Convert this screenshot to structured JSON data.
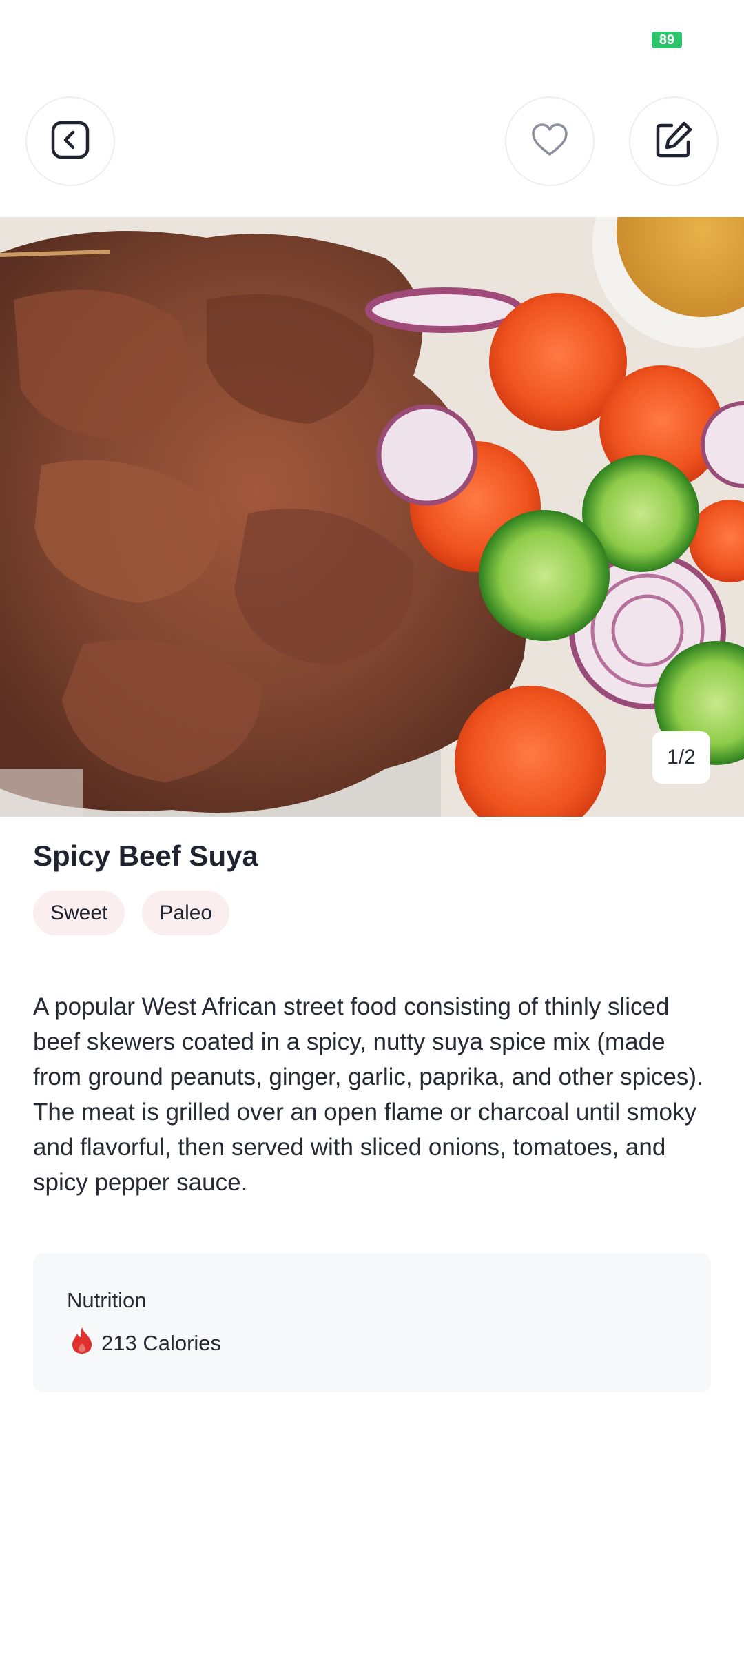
{
  "status_bar": {
    "battery": "89"
  },
  "toolbar": {
    "back_icon": "chevron-left-square-icon",
    "favorite_icon": "heart-outline-icon",
    "edit_icon": "edit-pencil-square-icon"
  },
  "gallery": {
    "counter": "1/2"
  },
  "recipe": {
    "title": "Spicy Beef Suya",
    "tags": [
      "Sweet",
      "Paleo"
    ],
    "description": "A popular West African street food consisting of thinly sliced beef skewers coated in a spicy, nutty suya spice mix (made from ground peanuts, ginger, garlic, paprika, and other spices). The meat is grilled over an open flame or charcoal until smoky and flavorful, then served with sliced onions, tomatoes, and spicy pepper sauce."
  },
  "nutrition": {
    "label": "Nutrition",
    "calories": "213 Calories",
    "icon": "flame-icon"
  },
  "colors": {
    "battery": "#2ec46b",
    "tag_background": "#fbeeee",
    "card_background": "#f7f8fa",
    "flame": "#e0312d"
  }
}
